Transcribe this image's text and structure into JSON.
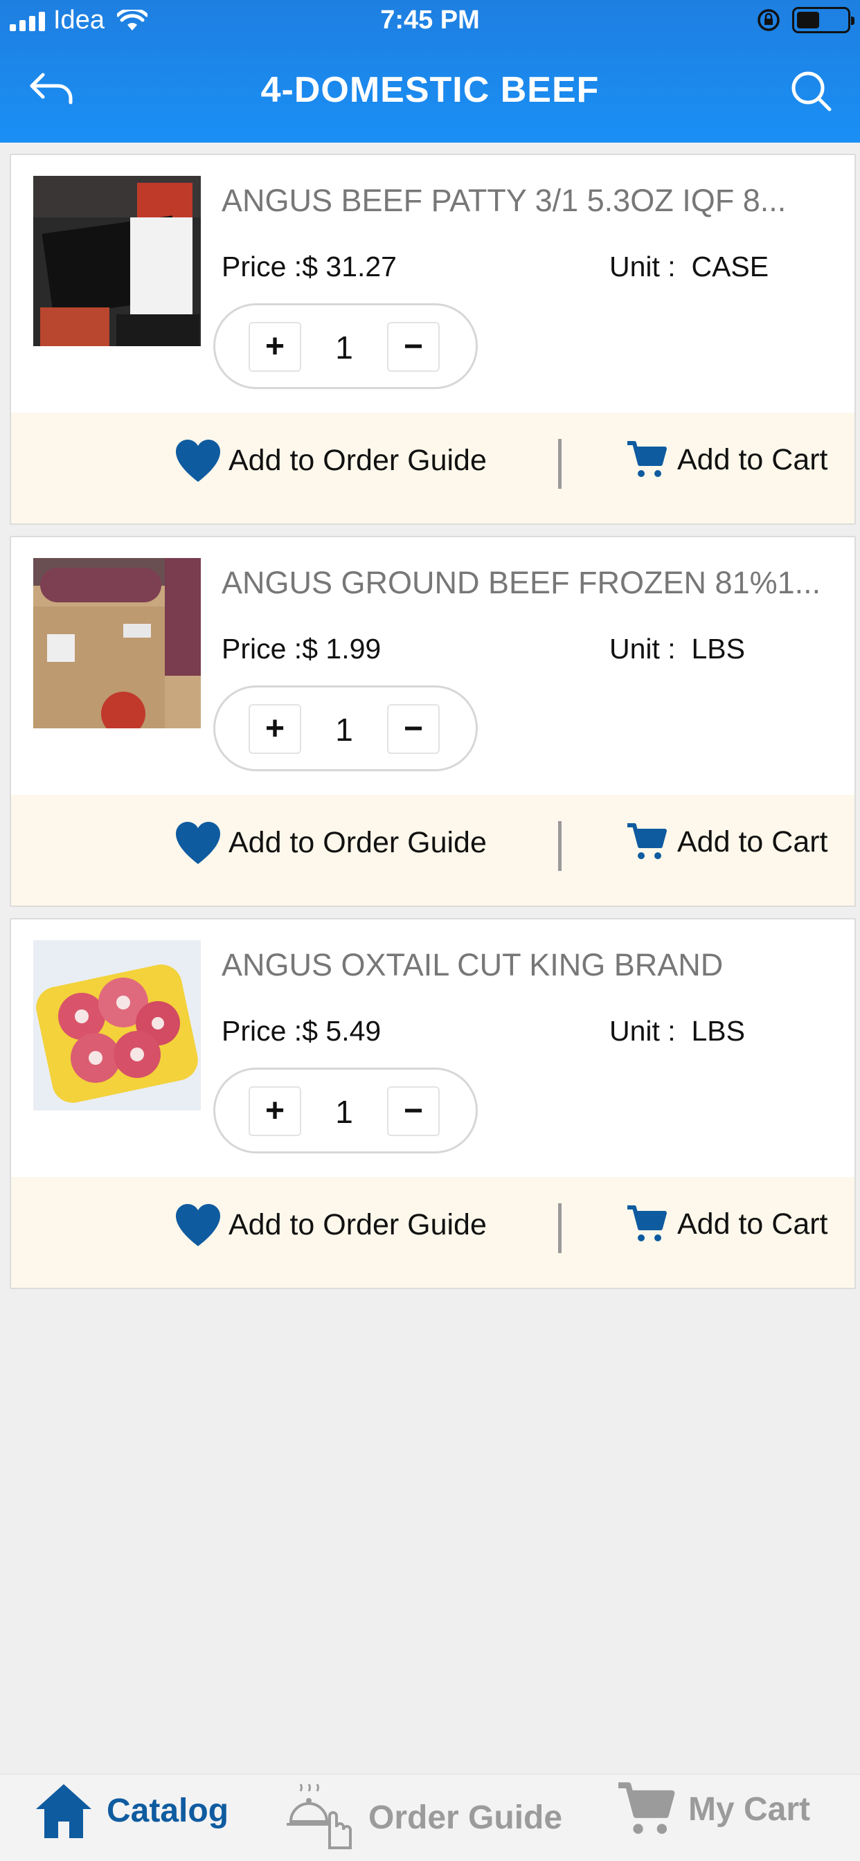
{
  "status_bar": {
    "carrier": "Idea",
    "time": "7:45 PM"
  },
  "header": {
    "title": "4-DOMESTIC BEEF"
  },
  "products": [
    {
      "name": "ANGUS BEEF PATTY 3/1 5.3OZ IQF 8...",
      "price": "Price :$ 31.27",
      "unit": "Unit :  CASE",
      "qty": "1"
    },
    {
      "name": "ANGUS GROUND BEEF FROZEN 81%1...",
      "price": "Price :$ 1.99",
      "unit": "Unit :  LBS",
      "qty": "1"
    },
    {
      "name": "ANGUS OXTAIL CUT KING BRAND",
      "price": "Price :$ 5.49",
      "unit": "Unit :  LBS",
      "qty": "1"
    }
  ],
  "labels": {
    "plus": "+",
    "minus": "−",
    "add_guide": "Add to Order Guide",
    "add_cart": "Add to Cart"
  },
  "tabs": {
    "catalog": "Catalog",
    "order_guide": "Order Guide",
    "my_cart": "My Cart"
  },
  "colors": {
    "header": "#1a8ff5",
    "accent": "#0f5ba0",
    "action_bar": "#fdf8eb",
    "inactive": "#9b9b9b"
  },
  "icons": {
    "back": "back-arrow-icon",
    "search": "search-icon",
    "heart": "heart-icon",
    "cart": "cart-icon",
    "home": "home-icon",
    "order_guide": "bell-hand-icon"
  }
}
